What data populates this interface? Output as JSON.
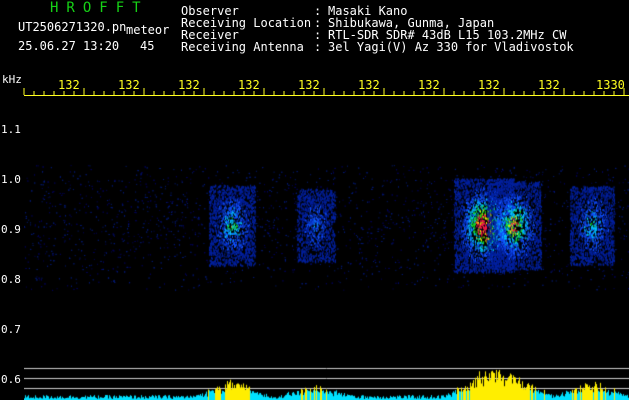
{
  "header": {
    "brand": "HROFFT",
    "filename": "UT2506271320.pn",
    "mode": "meteor",
    "datetime": "25.06.27 13:20",
    "count": "45"
  },
  "info": [
    {
      "label": "Observer",
      "sep": ":",
      "value": "Masaki Kano"
    },
    {
      "label": "Receiving Location",
      "sep": ":",
      "value": "Shibukawa, Gunma, Japan"
    },
    {
      "label": "Receiver",
      "sep": ":",
      "value": "RTL-SDR SDR# 43dB L15 103.2MHz CW"
    },
    {
      "label": "Receiving Antenna",
      "sep": ":",
      "value": "3el Yagi(V) Az 330 for Vladivostok"
    }
  ],
  "axis": {
    "unit": "kHz",
    "time_labels": [
      "132",
      "132",
      "132",
      "132",
      "132",
      "132",
      "132",
      "132",
      "132",
      "1330"
    ],
    "freq_ticks": [
      "1.1",
      "1.0",
      "0.9",
      "0.8",
      "0.7",
      "0.6"
    ]
  },
  "colors": {
    "background": "#000000",
    "brand": "#16d216",
    "time_label": "#ffff20",
    "power_low": "#00e0ff",
    "power_high": "#ffee00"
  },
  "spectrogram": {
    "signal_bands_khz": [
      0.78,
      1.03
    ],
    "center_khz": 0.91,
    "events": [
      {
        "minute_offset": 2.9,
        "strength": 0.65
      },
      {
        "minute_offset": 4.3,
        "strength": 0.45
      },
      {
        "minute_offset": 7.1,
        "strength": 1.0
      },
      {
        "minute_offset": 7.6,
        "strength": 0.85
      },
      {
        "minute_offset": 8.9,
        "strength": 0.6
      }
    ]
  }
}
